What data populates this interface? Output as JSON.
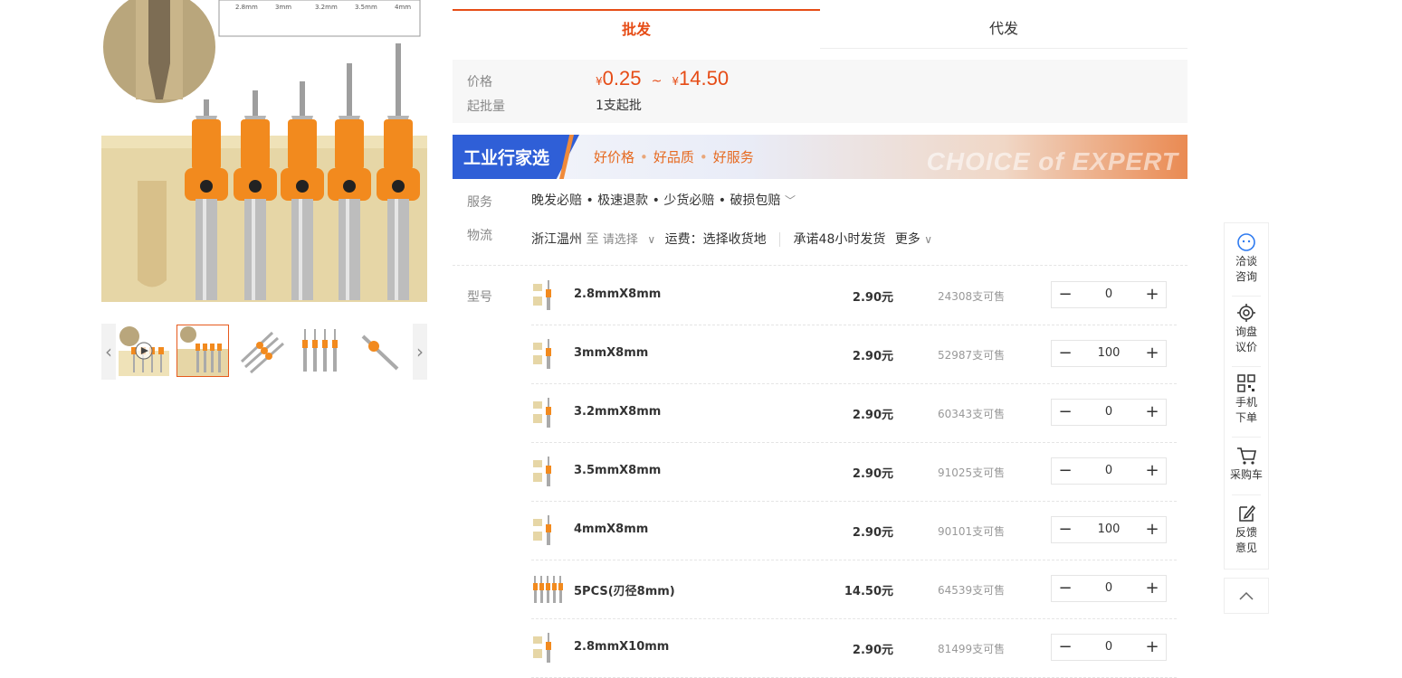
{
  "tabs": [
    {
      "label": "批发",
      "active": true
    },
    {
      "label": "代发",
      "active": false
    }
  ],
  "price": {
    "label": "价格",
    "currency": "¥",
    "min": "0.25",
    "separator": "~",
    "max": "14.50",
    "moq_label": "起批量",
    "moq_value": "1支起批"
  },
  "banner": {
    "title": "工业行家选",
    "slogans": [
      "好价格",
      "好品质",
      "好服务"
    ],
    "decor_text": "CHOICE of EXPERT"
  },
  "service": {
    "label": "服务",
    "text": "晚发必赔 • 极速退款 • 少货必赔 • 破损包赔"
  },
  "logistics": {
    "label": "物流",
    "origin": "浙江温州",
    "to": "至",
    "destination_placeholder": "请选择",
    "freight": "运费：选择收货地",
    "promise": "承诺48小时发货",
    "more": "更多"
  },
  "sku": {
    "label": "型号",
    "items": [
      {
        "name": "2.8mmX8mm",
        "price": "2.90元",
        "stock": "24308支可售",
        "qty": "0"
      },
      {
        "name": "3mmX8mm",
        "price": "2.90元",
        "stock": "52987支可售",
        "qty": "100"
      },
      {
        "name": "3.2mmX8mm",
        "price": "2.90元",
        "stock": "60343支可售",
        "qty": "0"
      },
      {
        "name": "3.5mmX8mm",
        "price": "2.90元",
        "stock": "91025支可售",
        "qty": "0"
      },
      {
        "name": "4mmX8mm",
        "price": "2.90元",
        "stock": "90101支可售",
        "qty": "100"
      },
      {
        "name": "5PCS(刃径8mm)",
        "price": "14.50元",
        "stock": "64539支可售",
        "qty": "0"
      },
      {
        "name": "2.8mmX10mm",
        "price": "2.90元",
        "stock": "81499支可售",
        "qty": "0"
      }
    ]
  },
  "toolbar": {
    "items": [
      {
        "label": "洽谈咨询",
        "icon": "chat-icon"
      },
      {
        "label": "询盘议价",
        "icon": "inquiry-icon"
      },
      {
        "label": "手机下单",
        "icon": "qrcode-icon"
      },
      {
        "label": "采购车",
        "icon": "cart-icon"
      },
      {
        "label": "反馈意见",
        "icon": "feedback-icon"
      }
    ],
    "back_to_top_icon": "chevron-up-icon"
  },
  "main_image_labels": [
    "2.8mm",
    "3mm",
    "3.2mm",
    "3.5mm",
    "4mm"
  ],
  "colors": {
    "accent": "#e64c16",
    "banner_blue": "#2f5fd7",
    "drill_orange": "#f28a1e"
  }
}
